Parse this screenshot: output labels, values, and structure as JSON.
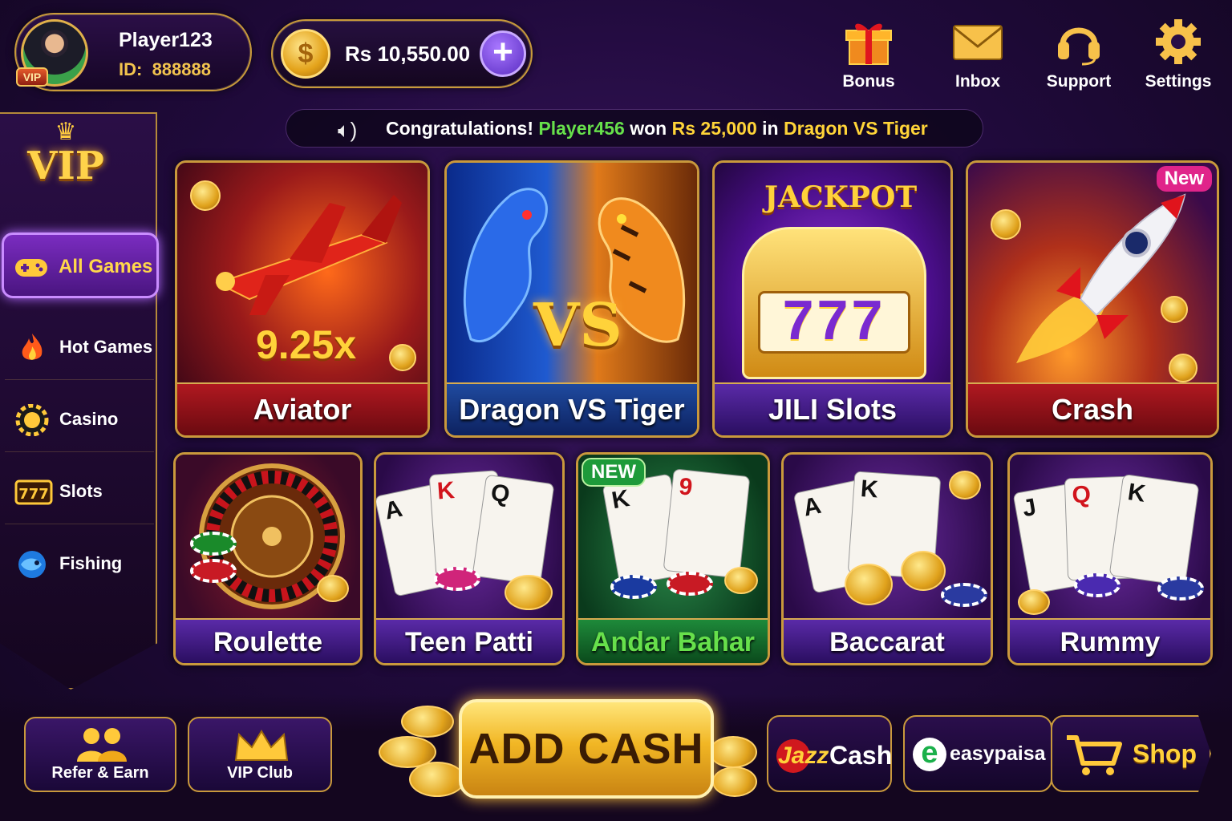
{
  "player": {
    "name": "Player123",
    "id_label": "ID:",
    "id": "888888",
    "vip_tag": "VIP"
  },
  "balance": {
    "currency_symbol": "$",
    "amount": "Rs 10,550.00",
    "add_symbol": "+"
  },
  "top_nav": [
    {
      "label": "Bonus",
      "icon": "gift-icon"
    },
    {
      "label": "Inbox",
      "icon": "mail-icon"
    },
    {
      "label": "Support",
      "icon": "headset-icon"
    },
    {
      "label": "Settings",
      "icon": "gear-icon"
    }
  ],
  "ticker": {
    "prefix": "Congratulations!",
    "player": "Player456",
    "verb": "won",
    "amount": "Rs 25,000",
    "in_word": "in",
    "game": "Dragon VS Tiger"
  },
  "sidebar": {
    "vip_badge": "VIP",
    "items": [
      {
        "label": "All Games",
        "icon": "gamepad-icon",
        "active": true
      },
      {
        "label": "Hot Games",
        "icon": "fire-icon",
        "active": false
      },
      {
        "label": "Casino",
        "icon": "chip-icon",
        "active": false
      },
      {
        "label": "Slots",
        "icon": "slot-777-icon",
        "active": false
      },
      {
        "label": "Fishing",
        "icon": "fish-icon",
        "active": false
      }
    ]
  },
  "games_row1": [
    {
      "title": "Aviator",
      "art_text": "9.25x"
    },
    {
      "title": "Dragon VS Tiger",
      "art_text": "VS"
    },
    {
      "title": "JILI Slots",
      "art_text": "JACKPOT",
      "art_text2": "777"
    },
    {
      "title": "Crash",
      "badge": "New"
    }
  ],
  "games_row2": [
    {
      "title": "Roulette"
    },
    {
      "title": "Teen Patti",
      "cards": [
        "A",
        "K",
        "Q"
      ]
    },
    {
      "title": "Andar Bahar",
      "badge": "NEW",
      "cards": [
        "K",
        "9"
      ]
    },
    {
      "title": "Baccarat",
      "cards": [
        "A",
        "K"
      ]
    },
    {
      "title": "Rummy",
      "cards": [
        "J",
        "Q",
        "K"
      ]
    }
  ],
  "bottom": {
    "refer": "Refer & Earn",
    "vip_club": "VIP Club",
    "add_cash": "ADD CASH",
    "jazzcash_a": "Jazz",
    "jazzcash_b": "Cash",
    "easypaisa_mark": "e",
    "easypaisa": "easypaisa",
    "shop": "Shop"
  },
  "colors": {
    "gold": "#c9993c",
    "accent_purple": "#7a2cc0",
    "win_green": "#67e04b",
    "win_yellow": "#ffd438"
  }
}
